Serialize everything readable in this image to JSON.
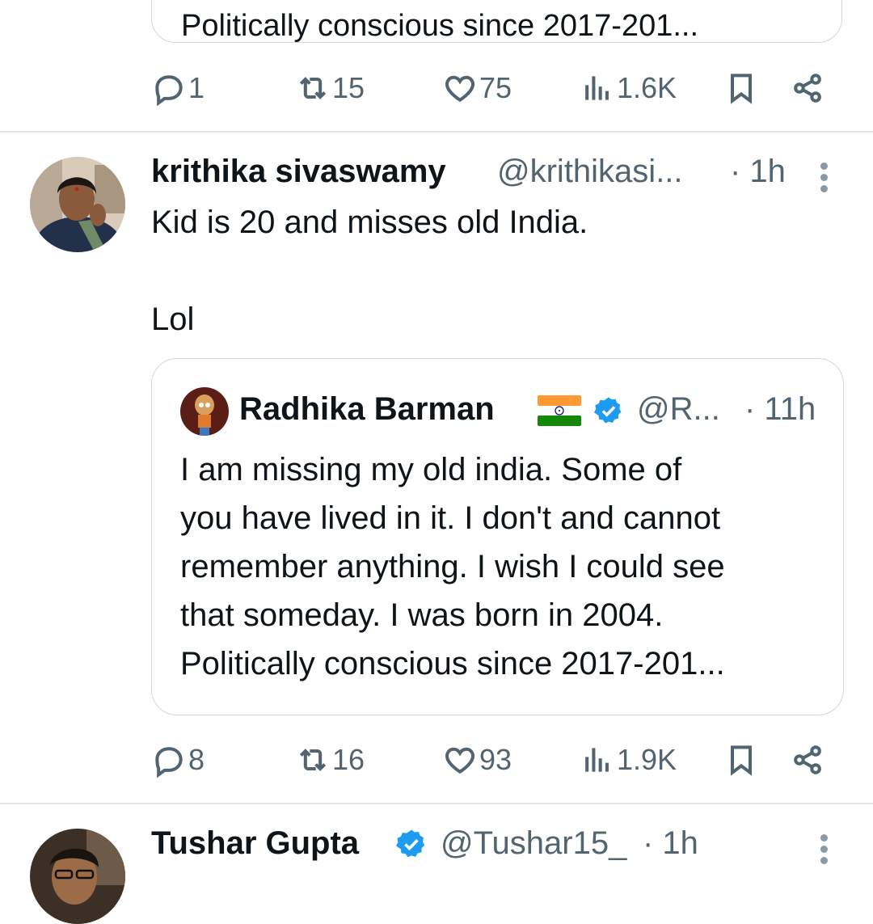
{
  "prev_tweet": {
    "quote_cut_text": "Politically conscious since 2017-201...",
    "actions": {
      "replies": "1",
      "reposts": "15",
      "likes": "75",
      "views": "1.6K"
    }
  },
  "tweet": {
    "author_name": "krithika sivaswamy",
    "author_handle": "@krithikasi...",
    "time": "· 1h",
    "text_line1": "Kid is 20 and misses old India.",
    "text_line2": "Lol",
    "quote": {
      "author_name": "Radhika Barman",
      "flag": "🇮🇳",
      "author_handle": "@R...",
      "time": "· 11h",
      "lines": [
        "I am missing my old india. Some of",
        "you have lived in it. I don't and cannot",
        "remember anything. I wish I could see",
        "that someday. I was born in 2004.",
        "Politically conscious since 2017-201..."
      ]
    },
    "actions": {
      "replies": "8",
      "reposts": "16",
      "likes": "93",
      "views": "1.9K"
    }
  },
  "next_tweet": {
    "author_name": "Tushar Gupta",
    "author_handle": "@Tushar15_",
    "time": "· 1h"
  },
  "colors": {
    "text": "#0f1419",
    "secondary": "#536471",
    "verified": "#1d9bf0",
    "border": "#cfd9de"
  },
  "icons": [
    "reply-icon",
    "repost-icon",
    "like-icon",
    "views-icon",
    "bookmark-icon",
    "share-icon",
    "more-icon",
    "verified-badge-icon"
  ]
}
